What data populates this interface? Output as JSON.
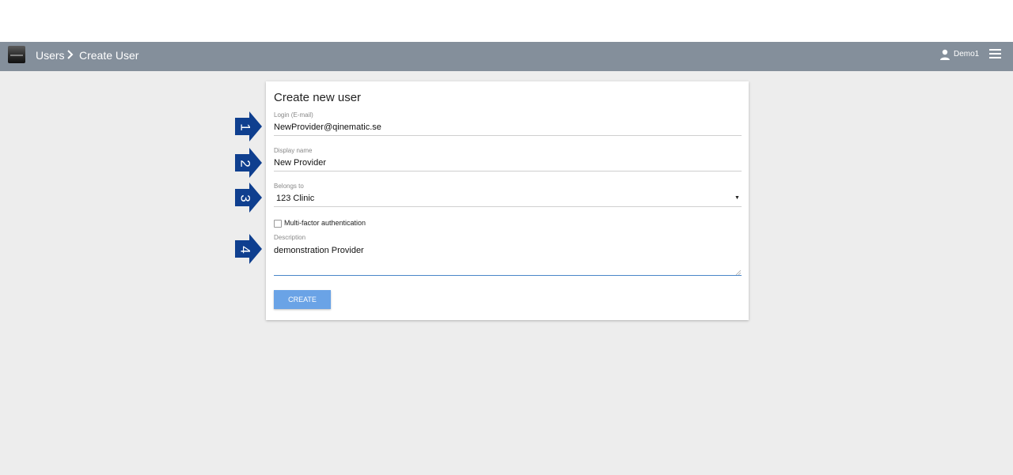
{
  "header": {
    "breadcrumb": {
      "parent": "Users",
      "current": "Create User"
    },
    "user_name": "Demo1",
    "bar_color": "#848f9b"
  },
  "form": {
    "title": "Create new user",
    "login": {
      "label": "Login (E-mail)",
      "value": "NewProvider@qinematic.se"
    },
    "display_name": {
      "label": "Display name",
      "value": "New Provider"
    },
    "belongs_to": {
      "label": "Belongs to",
      "value": "123 Clinic"
    },
    "mfa": {
      "label": "Multi-factor authentication",
      "checked": false
    },
    "description": {
      "label": "Description",
      "value": "demonstration Provider"
    },
    "create_label": "CREATE",
    "accent_color": "#6aa3e6"
  },
  "annotations": {
    "markers": [
      "1",
      "2",
      "3",
      "4"
    ],
    "color": "#0f3f8f"
  },
  "icons": [
    "app-logo",
    "chevron-right-icon",
    "user-icon",
    "hamburger-menu-icon",
    "dropdown-arrow-icon",
    "resize-grip-icon"
  ]
}
